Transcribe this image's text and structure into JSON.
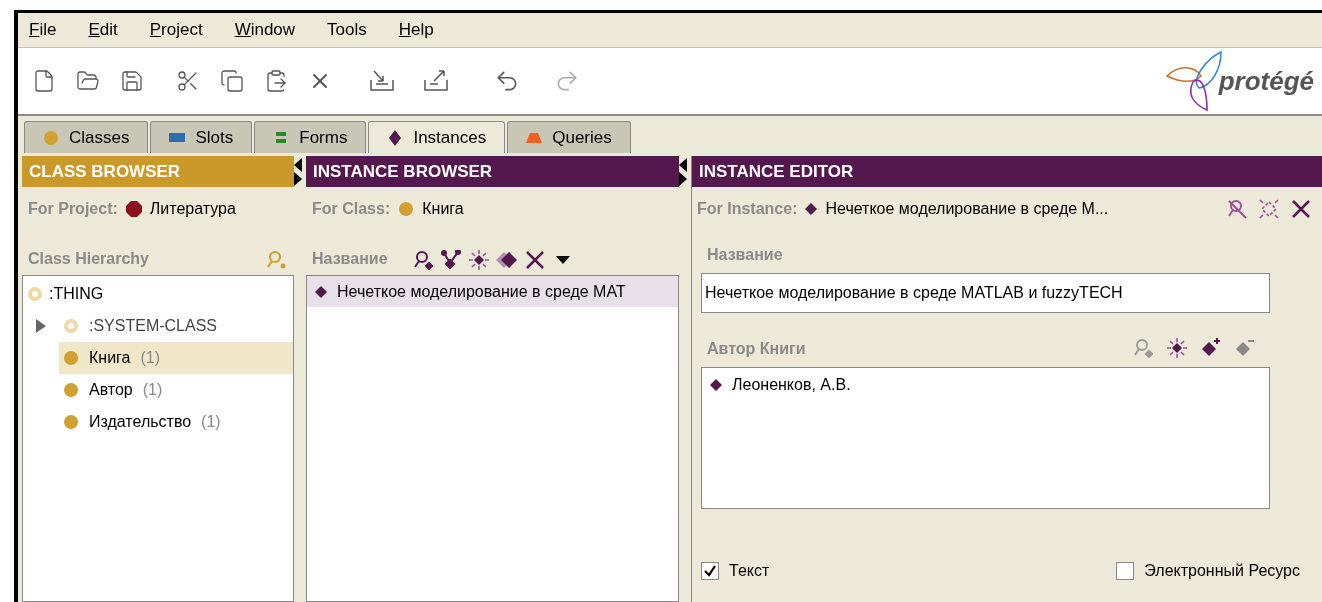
{
  "menu": [
    {
      "label": "File",
      "underlined": true
    },
    {
      "label": "Edit",
      "underlined": true
    },
    {
      "label": "Project",
      "underlined": true
    },
    {
      "label": "Window",
      "underlined": true
    },
    {
      "label": "Tools",
      "underlined": false
    },
    {
      "label": "Help",
      "underlined": true
    }
  ],
  "logo": {
    "text": "protégé"
  },
  "tabs": [
    {
      "label": "Classes",
      "kind": "circle",
      "color": "#d4a030",
      "selected": false
    },
    {
      "label": "Slots",
      "kind": "rect",
      "color": "#2a70b0",
      "selected": false
    },
    {
      "label": "Forms",
      "kind": "bars",
      "color": "#2a8a2a",
      "selected": false
    },
    {
      "label": "Instances",
      "kind": "diamond",
      "color": "#54174e",
      "selected": true
    },
    {
      "label": "Queries",
      "kind": "trapezoid",
      "color": "#f06020",
      "selected": false
    }
  ],
  "class_browser": {
    "title": "CLASS BROWSER",
    "project_label": "For Project:",
    "project": "Литература",
    "hierarchy_label": "Class Hierarchy",
    "tree": [
      {
        "label": ":THING",
        "kind": "system",
        "selected": false,
        "children": [
          {
            "label": ":SYSTEM-CLASS",
            "kind": "system",
            "selected": false,
            "expanded": false
          },
          {
            "label": "Книга",
            "count": "(1)",
            "kind": "class",
            "selected": true
          },
          {
            "label": "Автор",
            "count": "(1)",
            "kind": "class",
            "selected": false
          },
          {
            "label": "Издательство",
            "count": "(1)",
            "kind": "class",
            "selected": false
          }
        ]
      }
    ]
  },
  "instance_browser": {
    "title": "INSTANCE BROWSER",
    "class_label": "For Class:",
    "class": "Книга",
    "column": "Название",
    "instances": [
      {
        "label": "Нечеткое моделирование в среде MAT",
        "selected": true
      }
    ]
  },
  "instance_editor": {
    "title": "INSTANCE EDITOR",
    "instance_label": "For Instance:",
    "instance": "Нечеткое моделирование в среде M...",
    "name_label": "Название",
    "name_value": "Нечеткое моделирование в среде MATLAB и fuzzyTECH",
    "author_label": "Автор Книги",
    "authors": [
      "Леоненков, А.В."
    ],
    "checkboxes": [
      {
        "label": "Текст",
        "checked": true
      },
      {
        "label": "Электронный Ресурс",
        "checked": false
      }
    ]
  }
}
